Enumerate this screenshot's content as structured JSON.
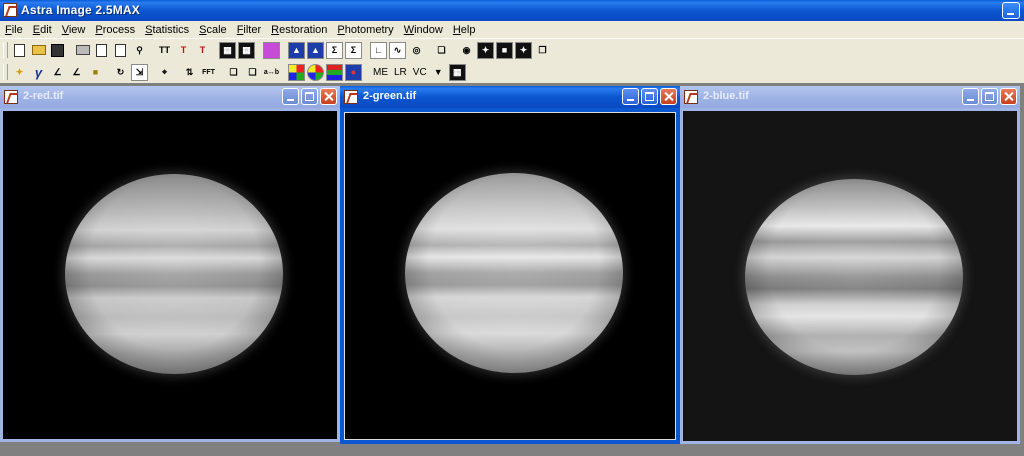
{
  "app": {
    "title": "Astra Image 2.5MAX"
  },
  "menu": [
    "File",
    "Edit",
    "View",
    "Process",
    "Statistics",
    "Scale",
    "Filter",
    "Restoration",
    "Photometry",
    "Window",
    "Help"
  ],
  "toolbar2_text": {
    "me": "ME",
    "lr": "LR",
    "vc": "VC",
    "fft": "FFT",
    "ab": "a↔b"
  },
  "windows": [
    {
      "title": "2-red.tif",
      "active": false
    },
    {
      "title": "2-green.tif",
      "active": true
    },
    {
      "title": "2-blue.tif",
      "active": false
    }
  ],
  "colors": {
    "xp_blue": "#0b57d0",
    "inactive_title": "#9fb3e5",
    "toolbar_bg": "#ece9d8",
    "mdi_bg": "#808080"
  }
}
